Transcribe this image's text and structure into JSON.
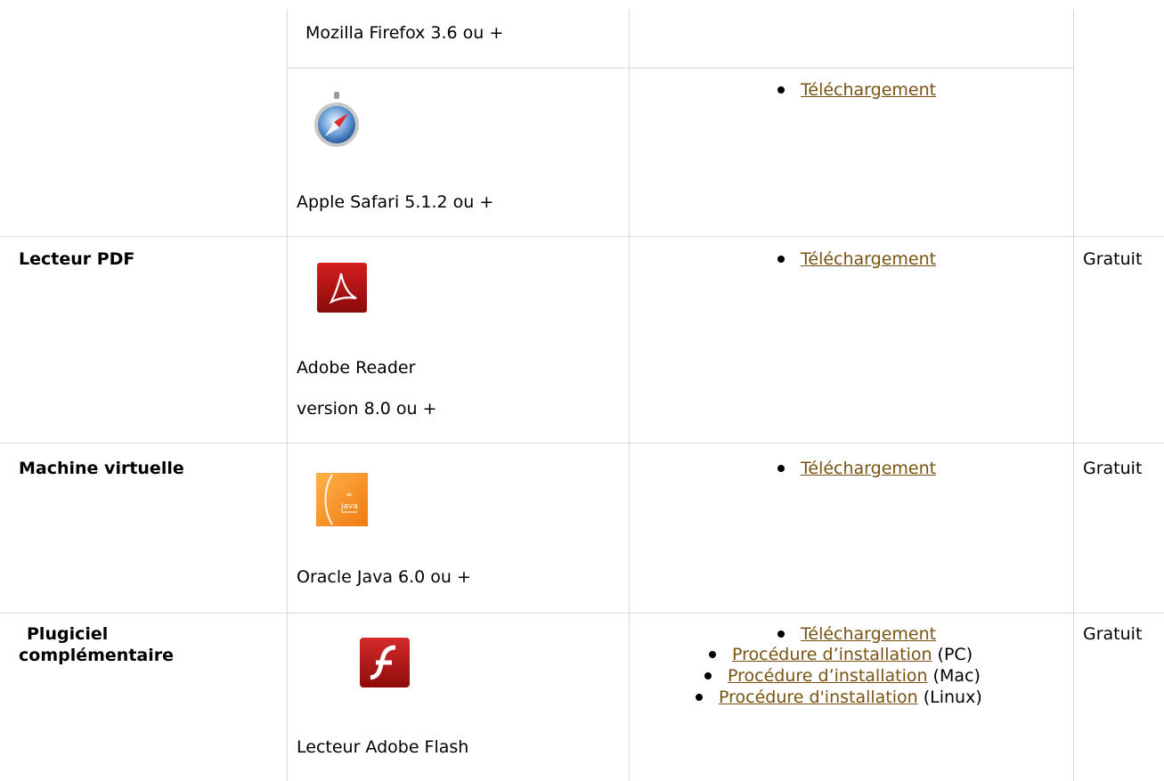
{
  "rows": [
    {
      "software": "Mozilla Firefox 3.6 ou +"
    },
    {
      "software": "Apple Safari 5.1.2 ou +",
      "icon": "safari-icon",
      "links": [
        "Téléchargement"
      ]
    },
    {
      "category": "Lecteur PDF",
      "software": [
        "Adobe Reader",
        "version 8.0 ou +"
      ],
      "icon": "adobe-reader-icon",
      "links": [
        "Téléchargement"
      ],
      "price": "Gratuit"
    },
    {
      "category": "Machine virtuelle",
      "software": "Oracle Java 6.0 ou +",
      "icon": "java-icon",
      "links": [
        "Téléchargement"
      ],
      "price": "Gratuit"
    },
    {
      "category": [
        "Plugiciel",
        "complémentaire"
      ],
      "software": "Lecteur Adobe Flash",
      "icon": "flash-icon",
      "links": [
        {
          "text": "Téléchargement",
          "suffix": ""
        },
        {
          "text": "Procédure d’installation",
          "suffix": " (PC)"
        },
        {
          "text": "Procédure d’installation",
          "suffix": " (Mac)"
        },
        {
          "text": "Procédure d'installation",
          "suffix": " (Linux)"
        }
      ],
      "price": "Gratuit"
    }
  ],
  "colors": {
    "link": "#7a5313",
    "grid": "#d9d9d9"
  }
}
